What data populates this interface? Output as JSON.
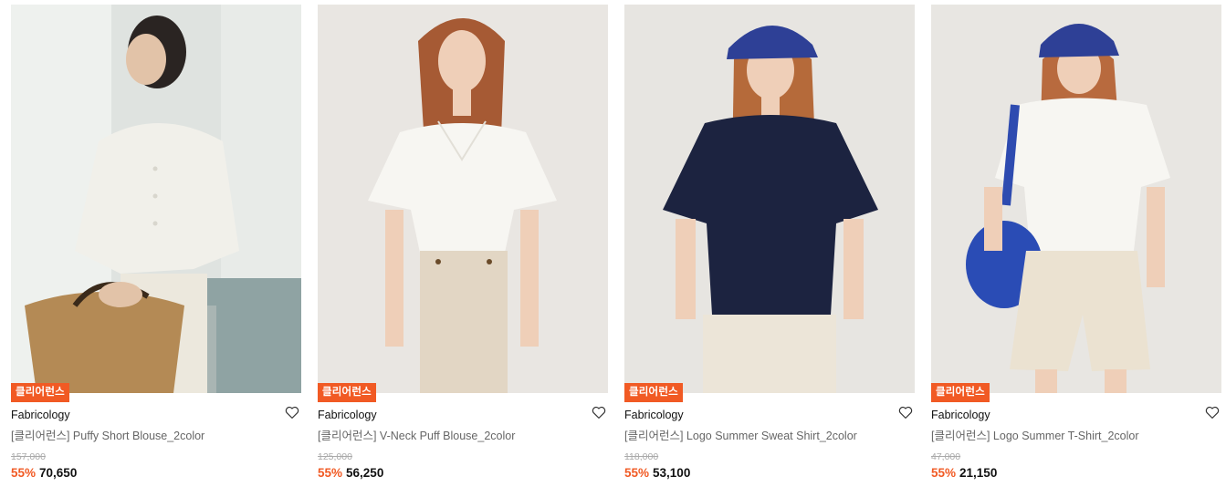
{
  "products": [
    {
      "badge": "클리어런스",
      "brand": "Fabricology",
      "name": "[클리어런스] Puffy Short Blouse_2color",
      "original_price": "157,000",
      "discount": "55%",
      "price": "70,650",
      "image_icon": "model-photo-puffy-blouse"
    },
    {
      "badge": "클리어런스",
      "brand": "Fabricology",
      "name": "[클리어런스] V-Neck Puff Blouse_2color",
      "original_price": "125,000",
      "discount": "55%",
      "price": "56,250",
      "image_icon": "model-photo-vneck-blouse"
    },
    {
      "badge": "클리어런스",
      "brand": "Fabricology",
      "name": "[클리어런스] Logo Summer Sweat Shirt_2color",
      "original_price": "118,000",
      "discount": "55%",
      "price": "53,100",
      "image_icon": "model-photo-sweat-shirt"
    },
    {
      "badge": "클리어런스",
      "brand": "Fabricology",
      "name": "[클리어런스] Logo Summer T-Shirt_2color",
      "original_price": "47,000",
      "discount": "55%",
      "price": "21,150",
      "image_icon": "model-photo-tshirt"
    }
  ],
  "colors": {
    "accent": "#f15a24",
    "price": "#111111",
    "muted": "#aaaaaa"
  }
}
